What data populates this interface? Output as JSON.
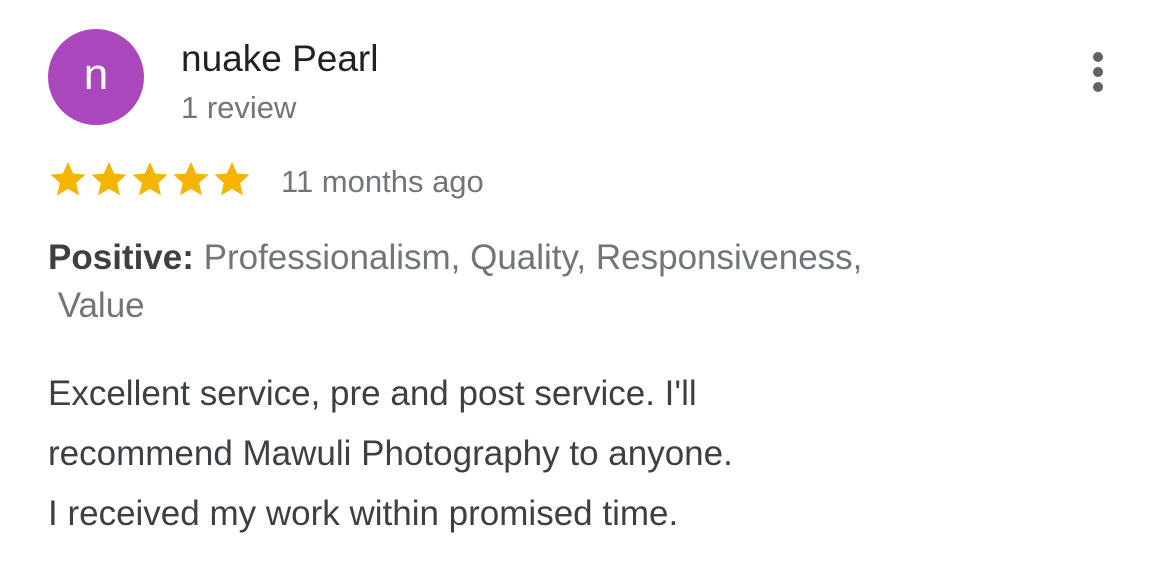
{
  "review": {
    "avatar_letter": "n",
    "avatar_color": "#ab47bc",
    "author_name": "nuake Pearl",
    "review_count": "1 review",
    "more_icon": "more-vert-icon",
    "rating": 5,
    "rating_max": 5,
    "star_color": "#f4b400",
    "time_ago": "11 months ago",
    "highlights_label": "Positive:",
    "highlights_line1": " Professionalism, Quality, Responsiveness,",
    "highlights_line2": " Value",
    "text_lines": [
      "Excellent service, pre and post service. I'll",
      "recommend Mawuli Photography to anyone.",
      "I received my work within promised time."
    ]
  }
}
